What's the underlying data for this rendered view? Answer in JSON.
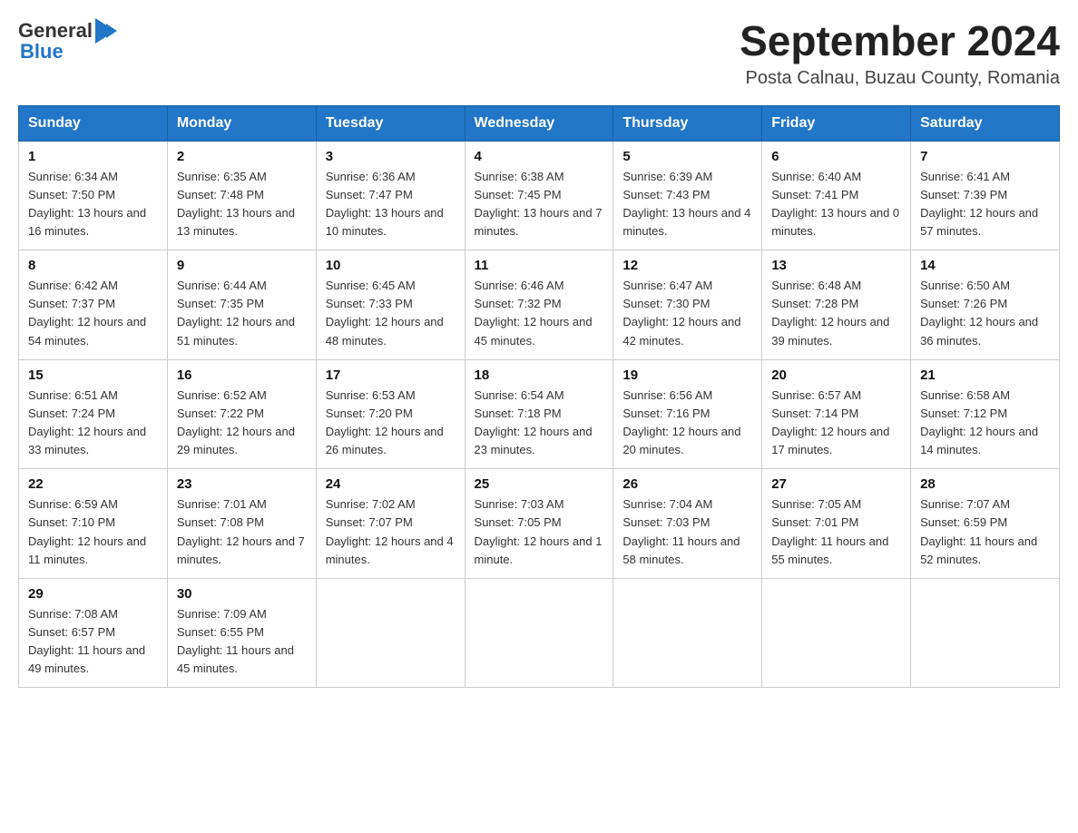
{
  "header": {
    "title": "September 2024",
    "subtitle": "Posta Calnau, Buzau County, Romania",
    "logo_general": "General",
    "logo_blue": "Blue"
  },
  "columns": [
    "Sunday",
    "Monday",
    "Tuesday",
    "Wednesday",
    "Thursday",
    "Friday",
    "Saturday"
  ],
  "weeks": [
    [
      {
        "day": "1",
        "sunrise": "Sunrise: 6:34 AM",
        "sunset": "Sunset: 7:50 PM",
        "daylight": "Daylight: 13 hours and 16 minutes."
      },
      {
        "day": "2",
        "sunrise": "Sunrise: 6:35 AM",
        "sunset": "Sunset: 7:48 PM",
        "daylight": "Daylight: 13 hours and 13 minutes."
      },
      {
        "day": "3",
        "sunrise": "Sunrise: 6:36 AM",
        "sunset": "Sunset: 7:47 PM",
        "daylight": "Daylight: 13 hours and 10 minutes."
      },
      {
        "day": "4",
        "sunrise": "Sunrise: 6:38 AM",
        "sunset": "Sunset: 7:45 PM",
        "daylight": "Daylight: 13 hours and 7 minutes."
      },
      {
        "day": "5",
        "sunrise": "Sunrise: 6:39 AM",
        "sunset": "Sunset: 7:43 PM",
        "daylight": "Daylight: 13 hours and 4 minutes."
      },
      {
        "day": "6",
        "sunrise": "Sunrise: 6:40 AM",
        "sunset": "Sunset: 7:41 PM",
        "daylight": "Daylight: 13 hours and 0 minutes."
      },
      {
        "day": "7",
        "sunrise": "Sunrise: 6:41 AM",
        "sunset": "Sunset: 7:39 PM",
        "daylight": "Daylight: 12 hours and 57 minutes."
      }
    ],
    [
      {
        "day": "8",
        "sunrise": "Sunrise: 6:42 AM",
        "sunset": "Sunset: 7:37 PM",
        "daylight": "Daylight: 12 hours and 54 minutes."
      },
      {
        "day": "9",
        "sunrise": "Sunrise: 6:44 AM",
        "sunset": "Sunset: 7:35 PM",
        "daylight": "Daylight: 12 hours and 51 minutes."
      },
      {
        "day": "10",
        "sunrise": "Sunrise: 6:45 AM",
        "sunset": "Sunset: 7:33 PM",
        "daylight": "Daylight: 12 hours and 48 minutes."
      },
      {
        "day": "11",
        "sunrise": "Sunrise: 6:46 AM",
        "sunset": "Sunset: 7:32 PM",
        "daylight": "Daylight: 12 hours and 45 minutes."
      },
      {
        "day": "12",
        "sunrise": "Sunrise: 6:47 AM",
        "sunset": "Sunset: 7:30 PM",
        "daylight": "Daylight: 12 hours and 42 minutes."
      },
      {
        "day": "13",
        "sunrise": "Sunrise: 6:48 AM",
        "sunset": "Sunset: 7:28 PM",
        "daylight": "Daylight: 12 hours and 39 minutes."
      },
      {
        "day": "14",
        "sunrise": "Sunrise: 6:50 AM",
        "sunset": "Sunset: 7:26 PM",
        "daylight": "Daylight: 12 hours and 36 minutes."
      }
    ],
    [
      {
        "day": "15",
        "sunrise": "Sunrise: 6:51 AM",
        "sunset": "Sunset: 7:24 PM",
        "daylight": "Daylight: 12 hours and 33 minutes."
      },
      {
        "day": "16",
        "sunrise": "Sunrise: 6:52 AM",
        "sunset": "Sunset: 7:22 PM",
        "daylight": "Daylight: 12 hours and 29 minutes."
      },
      {
        "day": "17",
        "sunrise": "Sunrise: 6:53 AM",
        "sunset": "Sunset: 7:20 PM",
        "daylight": "Daylight: 12 hours and 26 minutes."
      },
      {
        "day": "18",
        "sunrise": "Sunrise: 6:54 AM",
        "sunset": "Sunset: 7:18 PM",
        "daylight": "Daylight: 12 hours and 23 minutes."
      },
      {
        "day": "19",
        "sunrise": "Sunrise: 6:56 AM",
        "sunset": "Sunset: 7:16 PM",
        "daylight": "Daylight: 12 hours and 20 minutes."
      },
      {
        "day": "20",
        "sunrise": "Sunrise: 6:57 AM",
        "sunset": "Sunset: 7:14 PM",
        "daylight": "Daylight: 12 hours and 17 minutes."
      },
      {
        "day": "21",
        "sunrise": "Sunrise: 6:58 AM",
        "sunset": "Sunset: 7:12 PM",
        "daylight": "Daylight: 12 hours and 14 minutes."
      }
    ],
    [
      {
        "day": "22",
        "sunrise": "Sunrise: 6:59 AM",
        "sunset": "Sunset: 7:10 PM",
        "daylight": "Daylight: 12 hours and 11 minutes."
      },
      {
        "day": "23",
        "sunrise": "Sunrise: 7:01 AM",
        "sunset": "Sunset: 7:08 PM",
        "daylight": "Daylight: 12 hours and 7 minutes."
      },
      {
        "day": "24",
        "sunrise": "Sunrise: 7:02 AM",
        "sunset": "Sunset: 7:07 PM",
        "daylight": "Daylight: 12 hours and 4 minutes."
      },
      {
        "day": "25",
        "sunrise": "Sunrise: 7:03 AM",
        "sunset": "Sunset: 7:05 PM",
        "daylight": "Daylight: 12 hours and 1 minute."
      },
      {
        "day": "26",
        "sunrise": "Sunrise: 7:04 AM",
        "sunset": "Sunset: 7:03 PM",
        "daylight": "Daylight: 11 hours and 58 minutes."
      },
      {
        "day": "27",
        "sunrise": "Sunrise: 7:05 AM",
        "sunset": "Sunset: 7:01 PM",
        "daylight": "Daylight: 11 hours and 55 minutes."
      },
      {
        "day": "28",
        "sunrise": "Sunrise: 7:07 AM",
        "sunset": "Sunset: 6:59 PM",
        "daylight": "Daylight: 11 hours and 52 minutes."
      }
    ],
    [
      {
        "day": "29",
        "sunrise": "Sunrise: 7:08 AM",
        "sunset": "Sunset: 6:57 PM",
        "daylight": "Daylight: 11 hours and 49 minutes."
      },
      {
        "day": "30",
        "sunrise": "Sunrise: 7:09 AM",
        "sunset": "Sunset: 6:55 PM",
        "daylight": "Daylight: 11 hours and 45 minutes."
      },
      null,
      null,
      null,
      null,
      null
    ]
  ]
}
